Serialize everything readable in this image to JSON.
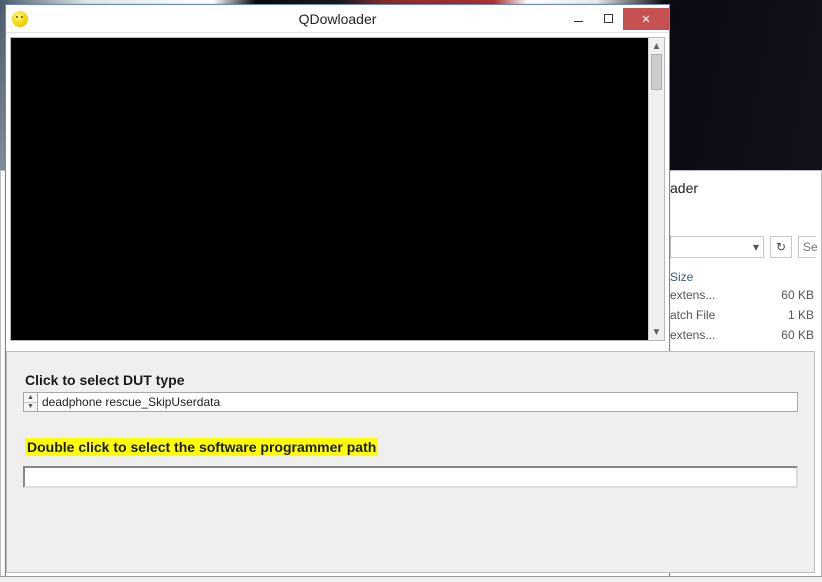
{
  "window": {
    "title": "QDowloader"
  },
  "panel": {
    "dut_label": "Click to select DUT type",
    "dut_value": "deadphone rescue_SkipUserdata",
    "path_label": "Double click to select the software programmer path",
    "path_value": ""
  },
  "bg_explorer": {
    "title_fragment": "ader",
    "search_placeholder": "Se",
    "size_header": "Size",
    "rows": [
      {
        "type": "extens...",
        "size": "60 KB"
      },
      {
        "type": "atch File",
        "size": "1 KB"
      },
      {
        "type": "extens...",
        "size": "60 KB"
      }
    ]
  }
}
